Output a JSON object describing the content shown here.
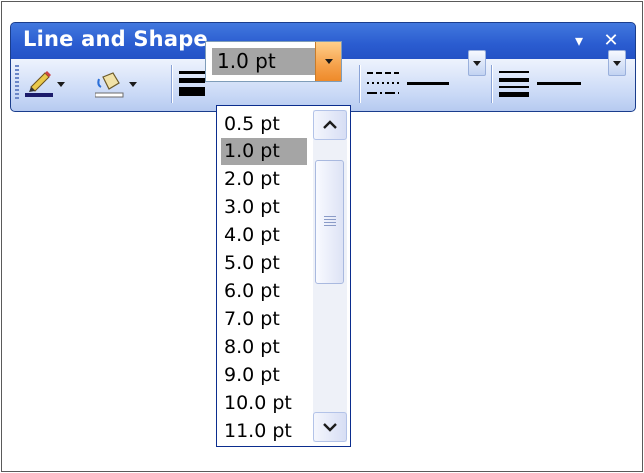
{
  "toolbar": {
    "title": "Line and Shape",
    "close_glyph": "✕",
    "options_glyph": "▾"
  },
  "line_weight": {
    "selected": "1.0 pt",
    "options": [
      "0.5 pt",
      "1.0 pt",
      "2.0 pt",
      "3.0 pt",
      "4.0 pt",
      "5.0 pt",
      "6.0 pt",
      "7.0 pt",
      "8.0 pt",
      "9.0 pt",
      "10.0 pt",
      "11.0 pt"
    ],
    "selected_index": 1
  },
  "icons": {
    "line_color": "pen-line-color-icon",
    "fill_color": "paint-bucket-fill-icon",
    "line_weight": "line-weight-icon",
    "dash_style": "dash-style-icon",
    "line_style": "line-style-icon"
  },
  "colors": {
    "title_bar": "#2a5cd0",
    "toolbar_row": "#c8d8f6",
    "combo_button": "#f5a14a",
    "selected_option": "#a5a5a5",
    "dropdown_border": "#0b2d8e"
  }
}
